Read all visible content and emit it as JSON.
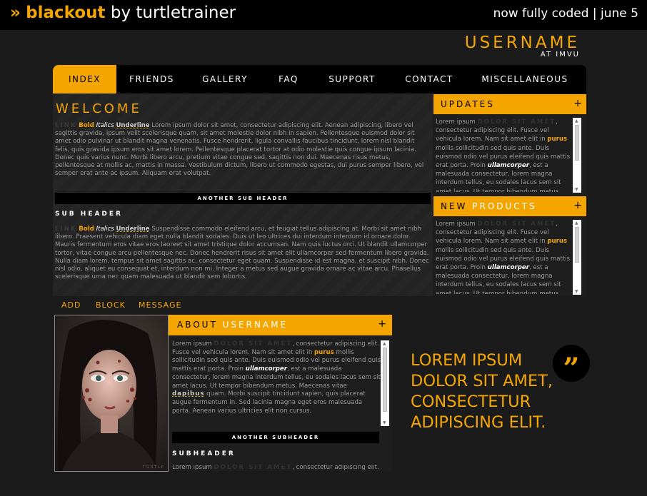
{
  "header": {
    "raquo": "»",
    "brand_name": "blackout",
    "brand_by": " by turtletrainer",
    "status": "now fully coded | june 5"
  },
  "profile": {
    "username": "USERNAME",
    "subtitle": "AT IMVU"
  },
  "nav": {
    "items": [
      {
        "label": "INDEX",
        "active": true
      },
      {
        "label": "FRIENDS"
      },
      {
        "label": "GALLERY"
      },
      {
        "label": "FAQ"
      },
      {
        "label": "SUPPORT"
      },
      {
        "label": "CONTACT"
      },
      {
        "label": "MISCELLANEOUS"
      }
    ]
  },
  "welcome": {
    "title": "WELCOME",
    "p1": {
      "link": "LINK",
      "bold": "Bold",
      "italics": "Italics",
      "underline": "Underline",
      "text": "Lorem ipsum dolor sit amet, consectetur adipiscing elit. Aenean adipiscing, libero vel sagittis gravida, ipsum velit scelerisque quam, sit amet molestie dolor nibh in sapien. Pellentesque euismod dolor sit amet odio pulvinar ut blandit magna venenatis. Fusce hendrerit, ligula convallis faucibus tincidunt, lorem nisl blandit felis, quis gravida ipsum eros sit amet lorem. Pellentesque placerat tortor at odio molestie quis congue ipsum lacinia. Donec quis varius nunc. Morbi libero arcu, pretium vitae congue sed, sagittis non dui. Maecenas risus metus, pellentesque at mollis ac, mattis in massa. Vestibulum dictum, libero ut commodo egestas, dui purus semper libero, vel semper erat ante ac ipsum. Aliquam erat volutpat."
    },
    "sub_bar": "ANOTHER SUB HEADER",
    "sub_header": "SUB HEADER",
    "p2": {
      "link": "LINK",
      "bold": "Bold",
      "italics": "Italics",
      "underline": "Underline",
      "text": "Suspendisse commodo eleifend arcu, et feugiat tellus adipiscing at. Morbi sit amet nibh libero. Praesent vehicula diam eget nulla blandit sodales. Duis ut leo ultrices dui interdum interdum id ornare dolor. Mauris fermentum eros vitae eros laoreet sit amet tristique dolor accumsan. Nam quis luctus orci. Ut blandit ullamcorper tortor, vitae congue arcu pellentesque nec. Donec hendrerit risus sit amet elit ullamcorper sed fermentum libero gravida. Nulla diam lorem, tempus sit amet sagittis ac, consectetur eget quam. Suspendisse id est magna, et suscipit nibh. Donec nisl odio, aliquet eu consequat et, interdum non mi. Integer a metus sed augue gravida ornare ac vitae arcu. Phasellus scelerisque urna nec quam malesuada ut blandit sem lobortis."
    }
  },
  "updates": {
    "title": "UPDATES",
    "plus": "+",
    "pre": "Lorem ipsum",
    "dark": "DOLOR SIT AMET",
    "t1": ", consectetur adipiscing elit. Fusce vel vehicula lorem. Nam sit amet elit in",
    "bold": "purus",
    "t2": "mollis sollicitudin sed quis ante. Duis euismod odio vel purus eleifend quis mattis erat porta. Proin",
    "italic": "ullamcorper",
    "t3": ", est a malesuada consectetur, lorem magna interdum tellus, eu sodales lacus sem sit amet lacus. Ut tempor bibendum metus."
  },
  "new_products": {
    "title_a": "NEW",
    "title_b": "PRODUCTS",
    "plus": "+",
    "pre": "Lorem ipsum",
    "dark": "DOLOR SIT AMET",
    "t1": ", consectetur adipiscing elit. Fusce vel vehicula lorem. Nam sit amet elit in",
    "bold": "purus",
    "t2": "mollis sollicitudin sed quis ante. Duis euismod odio vel purus eleifend quis mattis erat porta. Proin",
    "italic": "ullamcorper",
    "t3": ", est a malesuada consectetur, lorem magna interdum tellus, eu sodales lacus sem sit amet lacus. Ut tempor bibendum metus."
  },
  "actions": [
    "ADD",
    "BLOCK",
    "MESSAGE"
  ],
  "about": {
    "title_a": "ABOUT",
    "title_b": "USERNAME",
    "plus": "+",
    "pre": "Lorem ipsum",
    "dark": "DOLOR SIT AMET",
    "t1": ", consectetur adipiscing elit. Fusce vel vehicula lorem. Nam sit amet elit in",
    "bold": "purus",
    "t2": "mollis sollicitudin sed quis ante. Duis euismod odio vel purus eleifend quis mattis erat porta. Proin",
    "italic": "ullamcorper",
    "t3": ", est a malesuada consectetur, lorem magna interdum tellus, eu sodales lacus sem sit amet lacus. Ut tempor bibendum metus. Maecenas vitae",
    "underline": "dapibus",
    "t4": "quam. Morbi suscipit tincidunt sapien, quis placerat augue fermentum in. Sed lacinia magna eget eros malesuada porta. Aenean varius ultricies elit non cursus.",
    "sub_bar": "ANOTHER SUBHEADER",
    "sub_header": "SUBHEADER",
    "tail_pre": "Lorem ipsum",
    "tail_dark": "DOLOR SIT AMET",
    "tail_rest": ", consectetur adipiscing elit."
  },
  "avatar": {
    "watermark": "TURTLE"
  },
  "quote": {
    "text": "LOREM IPSUM DOLOR SIT AMET, CONSECTETUR ADIPISCING ELIT.",
    "mark": "”"
  },
  "colors": {
    "accent": "#f5a500",
    "background": "#1b1b1b",
    "bar": "#000000"
  }
}
